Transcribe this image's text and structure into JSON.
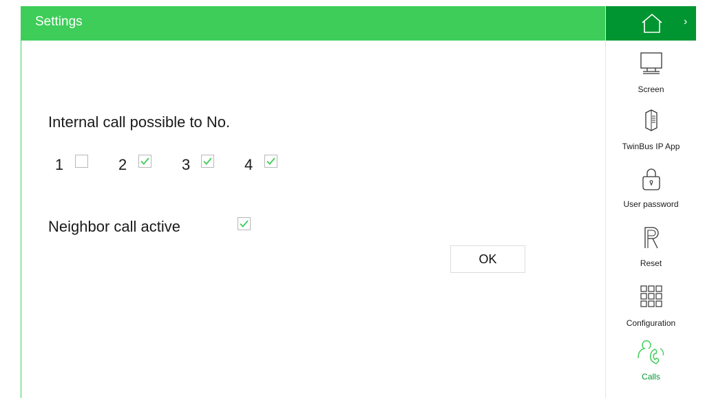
{
  "header": {
    "title": "Settings"
  },
  "main": {
    "internal_call_label": "Internal call possible to No.",
    "numbers": [
      {
        "label": "1",
        "checked": false
      },
      {
        "label": "2",
        "checked": true
      },
      {
        "label": "3",
        "checked": true
      },
      {
        "label": "4",
        "checked": true
      }
    ],
    "neighbor_call_label": "Neighbor call active",
    "neighbor_call_checked": true,
    "ok_label": "OK"
  },
  "sidebar": {
    "home_icon": "house-icon",
    "expand_icon": "chevron-right-icon",
    "items": [
      {
        "label": "Screen",
        "icon": "monitor-icon",
        "active": false
      },
      {
        "label": "TwinBus IP App",
        "icon": "app-icon",
        "active": false
      },
      {
        "label": "User password",
        "icon": "lock-icon",
        "active": false
      },
      {
        "label": "Reset",
        "icon": "reset-icon",
        "active": false
      },
      {
        "label": "Configuration",
        "icon": "grid-icon",
        "active": false
      },
      {
        "label": "Calls",
        "icon": "person-phone-icon",
        "active": true
      }
    ]
  },
  "colors": {
    "accent": "#3dcd58",
    "accent_dark": "#009530",
    "check": "#3dcd58"
  }
}
